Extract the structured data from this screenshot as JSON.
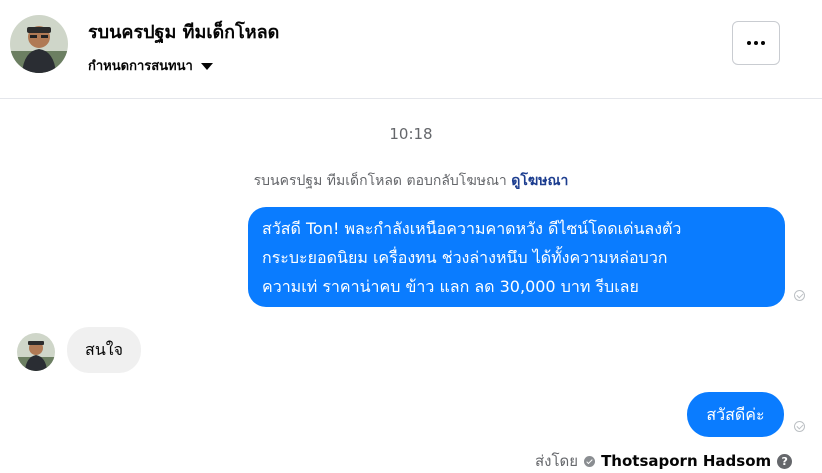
{
  "header": {
    "page_name": "รบนครปฐม ทีมเด็กโหลด",
    "settings_label": "กำหนดการสนทนา"
  },
  "conversation": {
    "timestamp": "10:18",
    "system_note": "รบนครปฐม ทีมเด็กโหลด ตอบกลับโฆษณา",
    "system_note_link": "ดูโฆษณา",
    "outgoing_ad_reply": {
      "lines": [
        "สวัสดี Ton! พละกำลังเหนือความคาดหวัง ดีไซน์โดดเด่นลงตัว",
        "กระบะยอดนิยม เครื่องทน ช่วงล่างหนึบ ได้ทั้งความหล่อบวก",
        "ความเท่ ราคาน่าคบ ข้าว แลก ลด 30,000 บาท รีบเลย"
      ]
    },
    "incoming_message": "สนใจ",
    "outgoing_reply": "สวัสดีค่ะ",
    "sent_by_label": "ส่งโดย",
    "sent_by_name": "Thotsaporn Hadsom"
  },
  "colors": {
    "outgoing_bubble": "#0a7cff",
    "incoming_bubble": "#f0f0f0",
    "link": "#1c3d8f"
  },
  "icons": {
    "more": "more-options-icon",
    "caret": "caret-down-icon",
    "seen": "seen-check-icon",
    "help": "help-icon",
    "verified": "verified-icon"
  }
}
